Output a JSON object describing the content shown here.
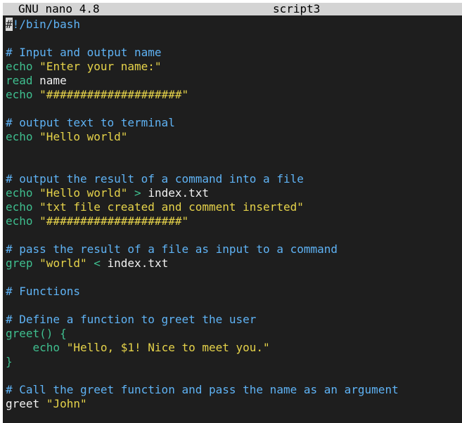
{
  "window": {
    "app_title": "GNU nano 4.8",
    "file_name": "script3"
  },
  "colors": {
    "background": "#1e1e1e",
    "titlebar": "#d4d4d4",
    "comment": "#5fb3f5",
    "keyword": "#3fbf8f",
    "string": "#e6d34a",
    "text": "#f2f2f2"
  },
  "editor": {
    "lines": [
      [
        {
          "t": "#",
          "c": "cursor"
        },
        {
          "t": "!/bin/bash",
          "c": "shebang"
        }
      ],
      [],
      [
        {
          "t": "# Input and output name",
          "c": "comment"
        }
      ],
      [
        {
          "t": "echo",
          "c": "builtin"
        },
        {
          "t": " ",
          "c": "plain"
        },
        {
          "t": "\"Enter your name:\"",
          "c": "string"
        }
      ],
      [
        {
          "t": "read",
          "c": "builtin"
        },
        {
          "t": " name",
          "c": "plain"
        }
      ],
      [
        {
          "t": "echo",
          "c": "builtin"
        },
        {
          "t": " ",
          "c": "plain"
        },
        {
          "t": "\"####################\"",
          "c": "string"
        }
      ],
      [],
      [
        {
          "t": "# output text to terminal",
          "c": "comment"
        }
      ],
      [
        {
          "t": "echo",
          "c": "builtin"
        },
        {
          "t": " ",
          "c": "plain"
        },
        {
          "t": "\"Hello world\"",
          "c": "string"
        }
      ],
      [],
      [],
      [
        {
          "t": "# output the result of a command into a file",
          "c": "comment"
        }
      ],
      [
        {
          "t": "echo",
          "c": "builtin"
        },
        {
          "t": " ",
          "c": "plain"
        },
        {
          "t": "\"Hello world\"",
          "c": "string"
        },
        {
          "t": " ",
          "c": "plain"
        },
        {
          "t": ">",
          "c": "op"
        },
        {
          "t": " index.txt",
          "c": "plain"
        }
      ],
      [
        {
          "t": "echo",
          "c": "builtin"
        },
        {
          "t": " ",
          "c": "plain"
        },
        {
          "t": "\"txt file created and comment inserted\"",
          "c": "string"
        }
      ],
      [
        {
          "t": "echo",
          "c": "builtin"
        },
        {
          "t": " ",
          "c": "plain"
        },
        {
          "t": "\"####################\"",
          "c": "string"
        }
      ],
      [],
      [
        {
          "t": "# pass the result of a file as input to a command",
          "c": "comment"
        }
      ],
      [
        {
          "t": "grep",
          "c": "builtin"
        },
        {
          "t": " ",
          "c": "plain"
        },
        {
          "t": "\"world\"",
          "c": "string"
        },
        {
          "t": " ",
          "c": "plain"
        },
        {
          "t": "<",
          "c": "op"
        },
        {
          "t": " index.txt",
          "c": "plain"
        }
      ],
      [],
      [
        {
          "t": "# Functions",
          "c": "comment"
        }
      ],
      [],
      [
        {
          "t": "# Define a function to greet the user",
          "c": "comment"
        }
      ],
      [
        {
          "t": "greet() {",
          "c": "func"
        }
      ],
      [
        {
          "t": "    ",
          "c": "plain"
        },
        {
          "t": "echo",
          "c": "builtin"
        },
        {
          "t": " ",
          "c": "plain"
        },
        {
          "t": "\"Hello, $1! Nice to meet you.\"",
          "c": "string"
        }
      ],
      [
        {
          "t": "}",
          "c": "func"
        }
      ],
      [],
      [
        {
          "t": "# Call the greet function and pass the name as an argument",
          "c": "comment"
        }
      ],
      [
        {
          "t": "greet",
          "c": "plain"
        },
        {
          "t": " ",
          "c": "plain"
        },
        {
          "t": "\"John\"",
          "c": "string"
        }
      ]
    ]
  }
}
